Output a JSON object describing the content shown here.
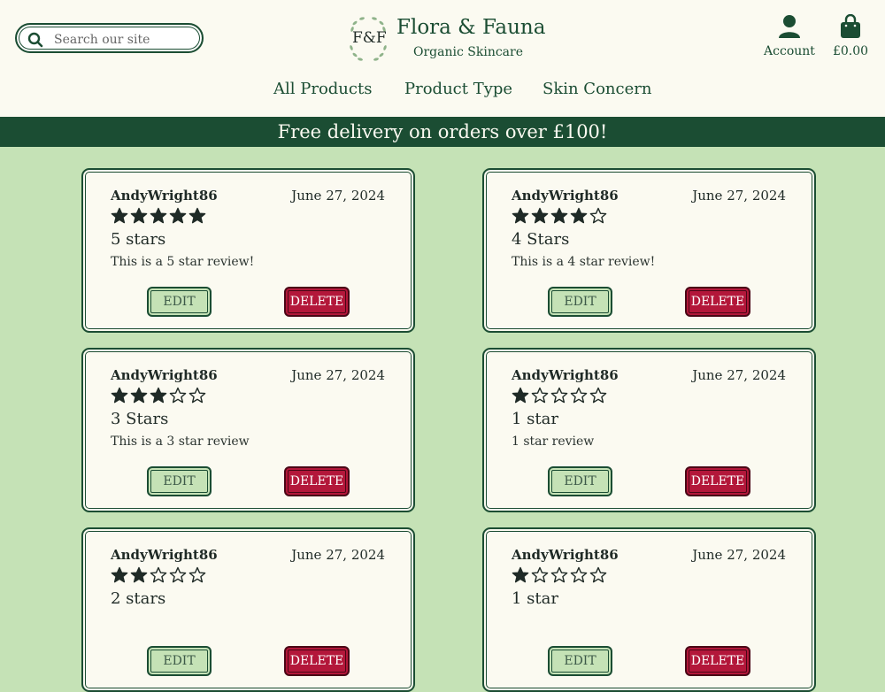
{
  "search": {
    "placeholder": "Search our site"
  },
  "brand": {
    "monogram": "F&F",
    "name": "Flora & Fauna",
    "tagline": "Organic Skincare"
  },
  "account": {
    "label": "Account"
  },
  "cart": {
    "total": "£0.00"
  },
  "nav": {
    "items": [
      "All Products",
      "Product Type",
      "Skin Concern"
    ]
  },
  "banner": {
    "text": "Free delivery on orders over £100!"
  },
  "actions": {
    "edit_label": "EDIT",
    "delete_label": "DELETE"
  },
  "colors": {
    "primary": "#1b4d33",
    "page_bg": "#c5e2b6",
    "card_bg": "#fbfaf1",
    "delete": "#b3173a"
  },
  "reviews": [
    {
      "user": "AndyWright86",
      "date": "June 27, 2024",
      "rating": 5,
      "title": "5 stars",
      "text": "This is a 5 star review!"
    },
    {
      "user": "AndyWright86",
      "date": "June 27, 2024",
      "rating": 4,
      "title": "4 Stars",
      "text": "This is a 4 star review!"
    },
    {
      "user": "AndyWright86",
      "date": "June 27, 2024",
      "rating": 3,
      "title": "3 Stars",
      "text": "This is a 3 star review"
    },
    {
      "user": "AndyWright86",
      "date": "June 27, 2024",
      "rating": 1,
      "title": "1 star",
      "text": "1 star review"
    },
    {
      "user": "AndyWright86",
      "date": "June 27, 2024",
      "rating": 2,
      "title": "2 stars",
      "text": ""
    },
    {
      "user": "AndyWright86",
      "date": "June 27, 2024",
      "rating": 1,
      "title": "1 star",
      "text": ""
    }
  ]
}
